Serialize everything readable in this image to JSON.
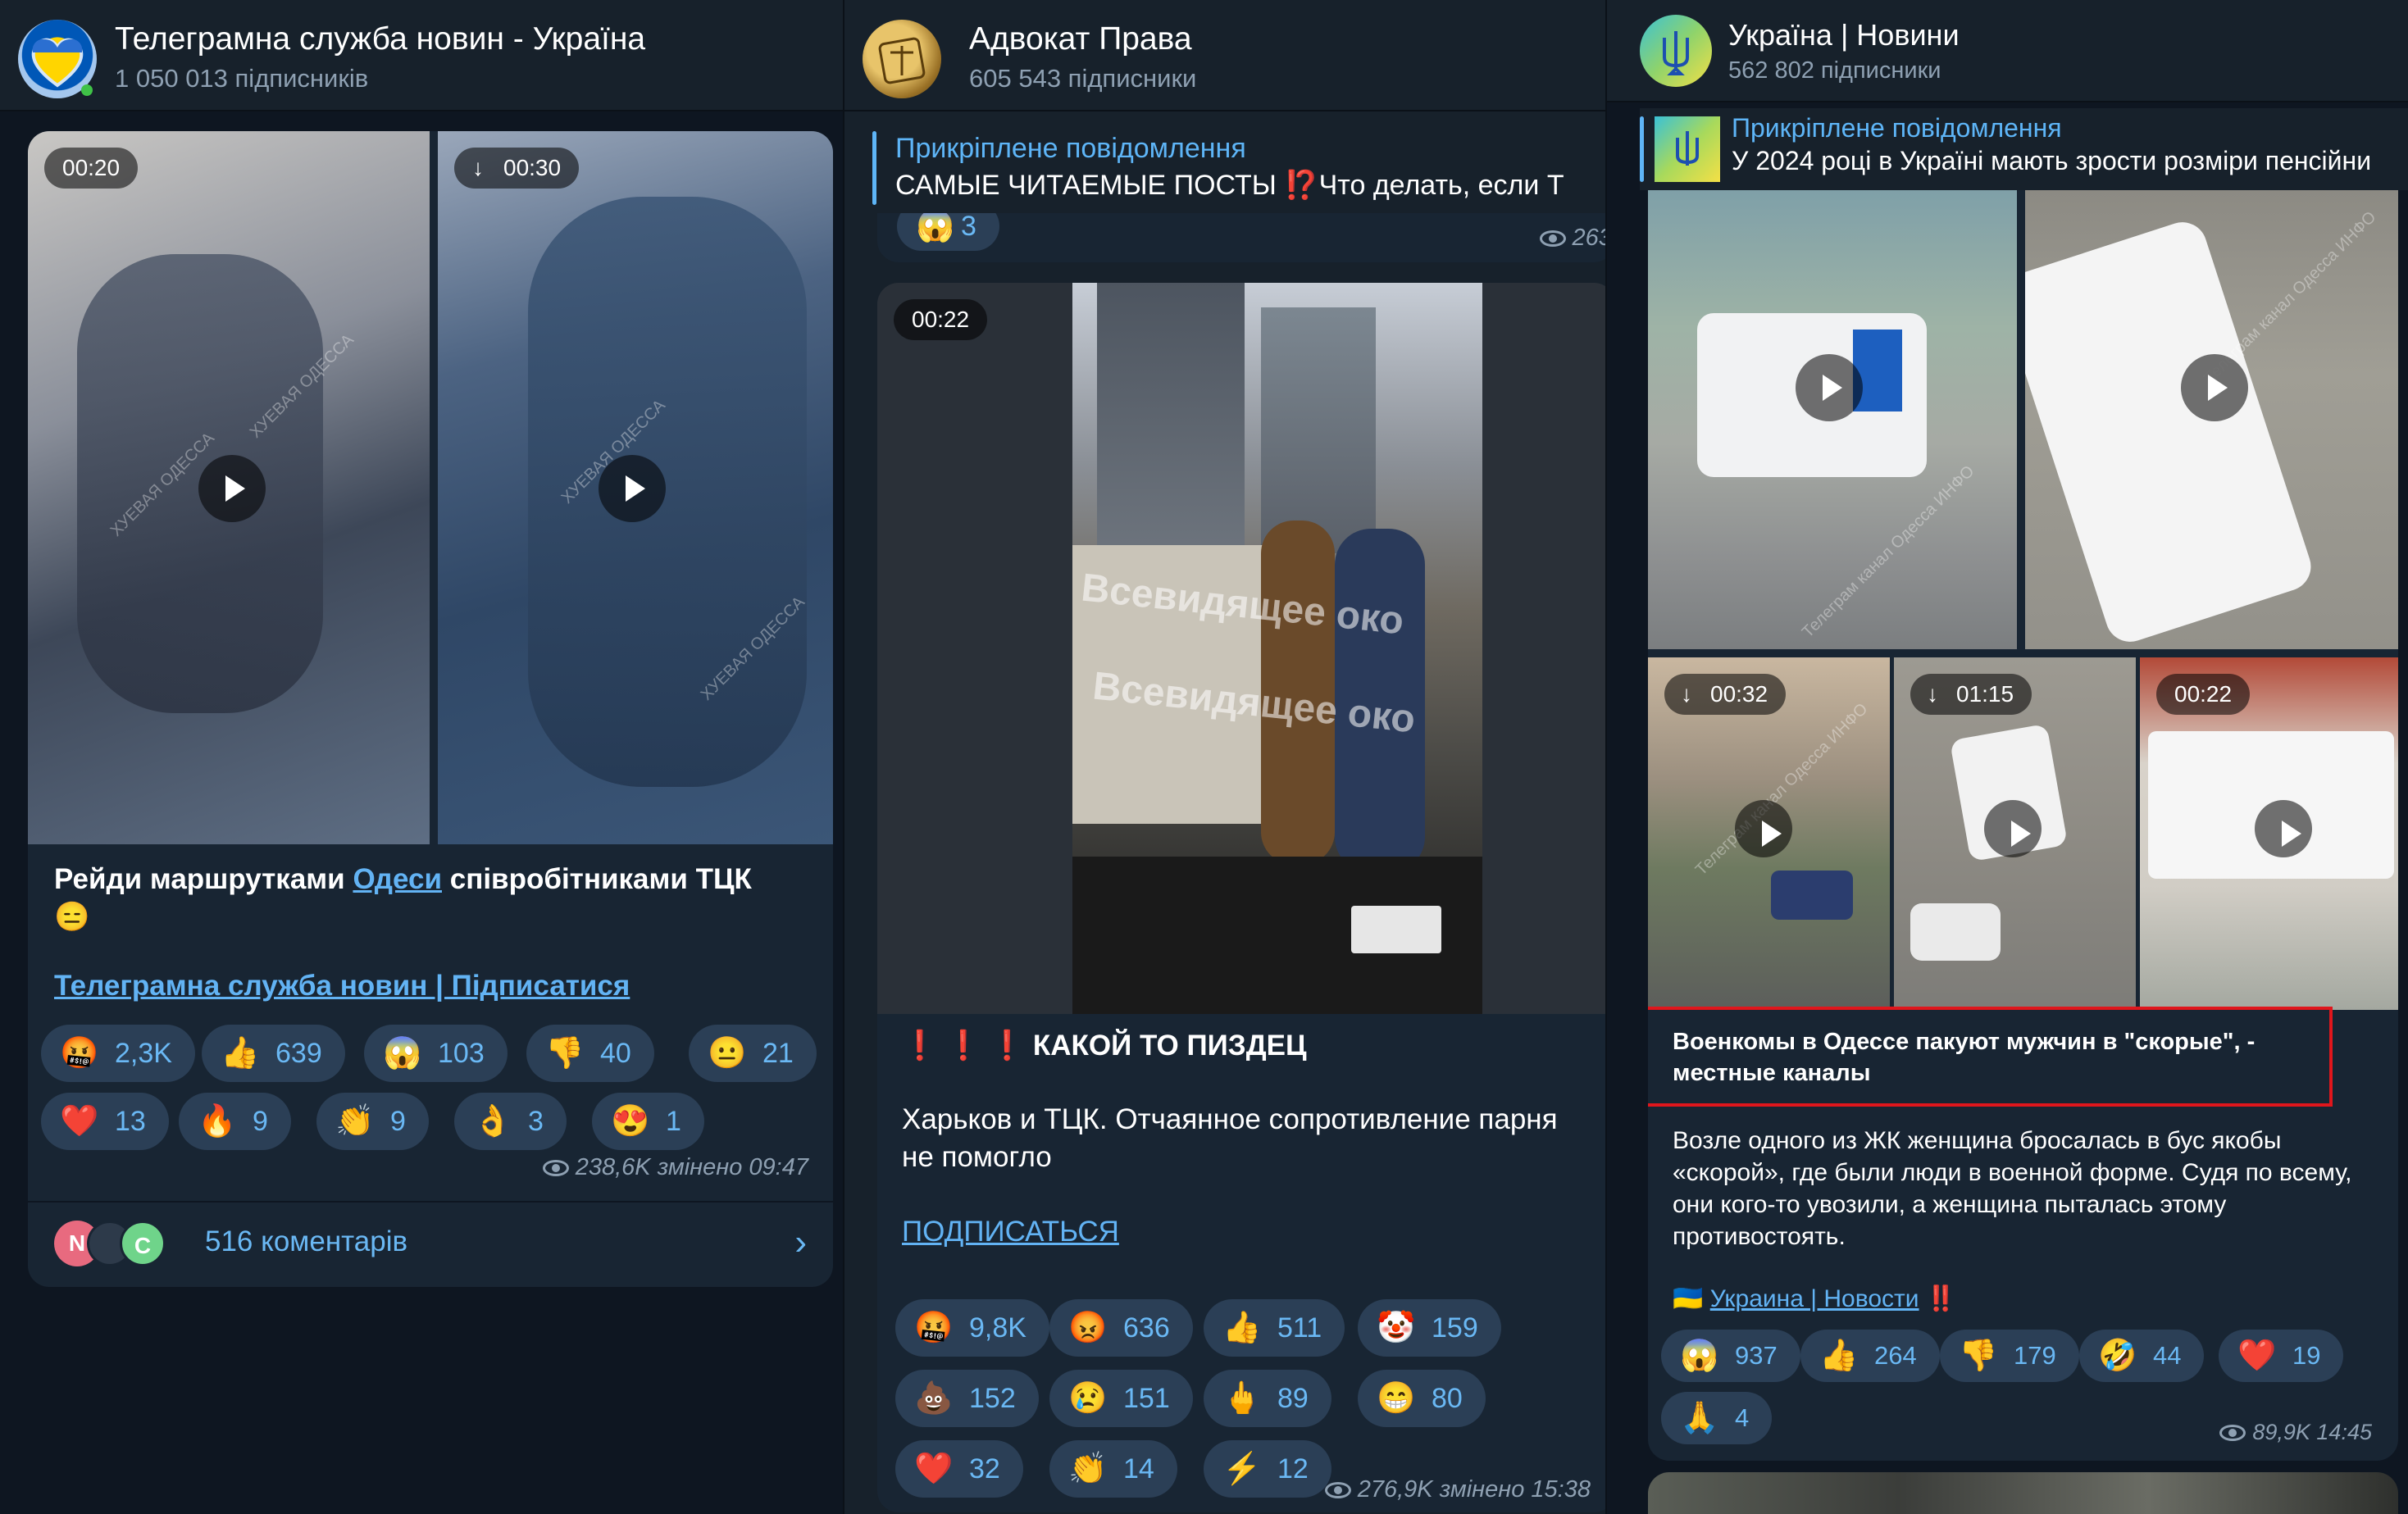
{
  "panel1": {
    "title": "Телеграмна служба новин - Україна",
    "subscribers": "1 050 013 підписників",
    "video1_duration": "00:20",
    "video2_duration": "00:30",
    "watermark": "ХУЕВАЯ ОДЕССА",
    "caption_pre": "Рейди маршрутками ",
    "caption_link": "Одеси",
    "caption_post": " співробітниками ТЦК",
    "caption_emoji": "😑",
    "subscribe_link": "Телеграмна служба новин | Підписатися",
    "reactions": [
      {
        "emoji": "🤬",
        "count": "2,3K"
      },
      {
        "emoji": "👍",
        "count": "639"
      },
      {
        "emoji": "😱",
        "count": "103"
      },
      {
        "emoji": "👎",
        "count": "40"
      },
      {
        "emoji": "😐",
        "count": "21"
      },
      {
        "emoji": "❤️",
        "count": "13"
      },
      {
        "emoji": "🔥",
        "count": "9"
      },
      {
        "emoji": "👏",
        "count": "9"
      },
      {
        "emoji": "👌",
        "count": "3"
      },
      {
        "emoji": "😍",
        "count": "1"
      }
    ],
    "views": "238,6K змінено 09:47",
    "comment_avatars": [
      "N",
      "",
      "C"
    ],
    "comments": "516 коментарів",
    "colors": {
      "link": "#62b3f4",
      "chip": "#2b3f56"
    }
  },
  "panel2": {
    "title": "Адвокат Права",
    "subscribers": "605 543 підписники",
    "pinned_title": "Прикріплене повідомлення",
    "pinned_text": "САМЫЕ ЧИТАЕМЫЕ ПОСТЫ  ⁉️Что делать, если Т",
    "prev_reaction": {
      "emoji": "😱",
      "count": "3"
    },
    "prev_views": "263,",
    "video_duration": "00:22",
    "watermark": "Всевидящее око",
    "headline_marks": "❗ ❗ ❗",
    "headline": "КАКОЙ ТО ПИЗДЕЦ",
    "body": "Харьков и ТЦК. Отчаянное сопротивление парня не помогло",
    "subscribe": "ПОДПИСАТЬСЯ",
    "reactions": [
      {
        "emoji": "🤬",
        "count": "9,8K"
      },
      {
        "emoji": "😡",
        "count": "636"
      },
      {
        "emoji": "👍",
        "count": "511"
      },
      {
        "emoji": "🤡",
        "count": "159"
      },
      {
        "emoji": "💩",
        "count": "152"
      },
      {
        "emoji": "😢",
        "count": "151"
      },
      {
        "emoji": "🖕",
        "count": "89"
      },
      {
        "emoji": "😁",
        "count": "80"
      },
      {
        "emoji": "❤️",
        "count": "32"
      },
      {
        "emoji": "👏",
        "count": "14"
      },
      {
        "emoji": "⚡",
        "count": "12"
      }
    ],
    "views": "276,9K змінено 15:38"
  },
  "panel3": {
    "title": "Україна | Новини",
    "subscribers": "562 802 підписники",
    "pinned_title": "Прикріплене повідомлення",
    "pinned_text": "У 2024 році в Україні мають зрости розміри пенсійни",
    "durations": [
      "00:32",
      "01:15",
      "00:22"
    ],
    "watermark": "Телеграм канал Одесса ИНФО",
    "headline": "Военкомы в Одессе пакуют мужчин в \"скорые\", - местные каналы",
    "body": "Возле одного из ЖК женщина бросалась в бус якобы «скорой», где были люди в военной форме. Судя по всему, они кого-то увозили, а женщина пыталась этому противостоять.",
    "source_flag": "🇺🇦",
    "source_link": "Украина | Новости",
    "source_marks": "‼️",
    "reactions": [
      {
        "emoji": "😱",
        "count": "937"
      },
      {
        "emoji": "👍",
        "count": "264"
      },
      {
        "emoji": "👎",
        "count": "179"
      },
      {
        "emoji": "🤣",
        "count": "44"
      },
      {
        "emoji": "❤️",
        "count": "19"
      },
      {
        "emoji": "🙏",
        "count": "4"
      }
    ],
    "views": "89,9K 14:45",
    "highlight_color": "#e0161c"
  }
}
